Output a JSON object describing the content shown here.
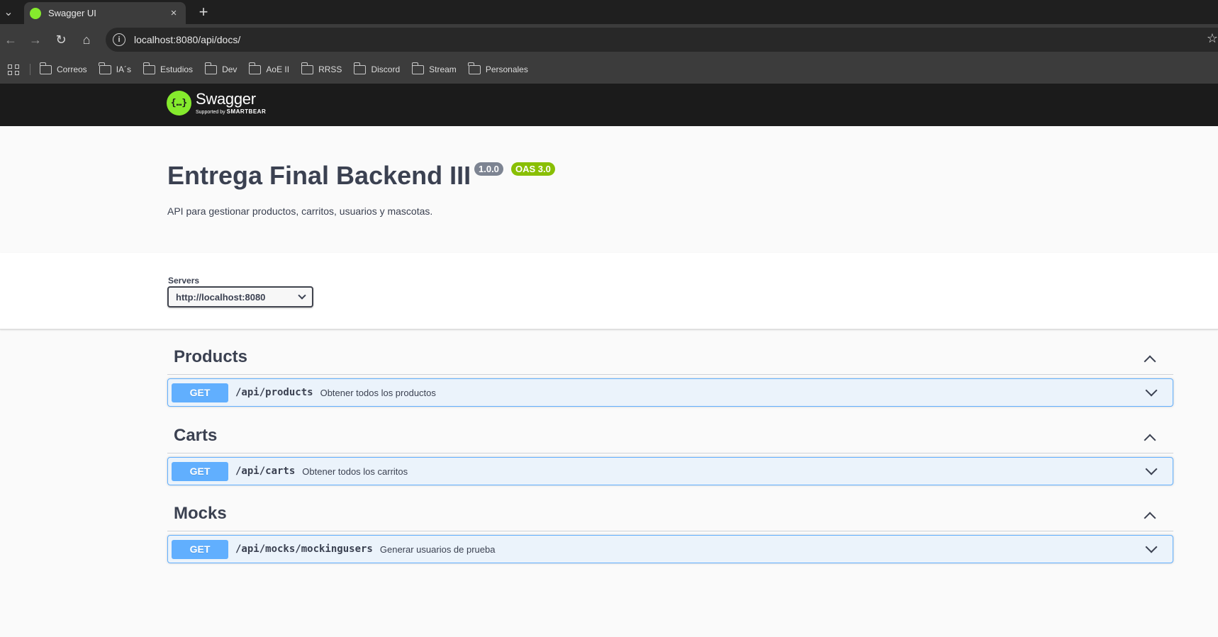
{
  "browser": {
    "tab_title": "Swagger UI",
    "tab_close": "×",
    "new_tab": "+",
    "url": "localhost:8080/api/docs/",
    "bookmarks": [
      {
        "label": "Correos"
      },
      {
        "label": "IA´s"
      },
      {
        "label": "Estudios"
      },
      {
        "label": "Dev"
      },
      {
        "label": "AoE II"
      },
      {
        "label": "RRSS"
      },
      {
        "label": "Discord"
      },
      {
        "label": "Stream"
      },
      {
        "label": "Personales"
      }
    ]
  },
  "swagger": {
    "logo_name": "Swagger",
    "logo_sub_prefix": "Supported by",
    "logo_sub_brand": "SMARTBEAR",
    "logo_glyph": "{…}",
    "accent_color": "#85ea2d"
  },
  "info": {
    "title": "Entrega Final Backend III",
    "version": "1.0.0",
    "oas": "OAS 3.0",
    "description": "API para gestionar productos, carritos, usuarios y mascotas."
  },
  "servers": {
    "label": "Servers",
    "selected": "http://localhost:8080"
  },
  "tags": [
    {
      "name": "Products",
      "operations": [
        {
          "method": "GET",
          "path": "/api/products",
          "summary": "Obtener todos los productos"
        }
      ]
    },
    {
      "name": "Carts",
      "operations": [
        {
          "method": "GET",
          "path": "/api/carts",
          "summary": "Obtener todos los carritos"
        }
      ]
    },
    {
      "name": "Mocks",
      "operations": [
        {
          "method": "GET",
          "path": "/api/mocks/mockingusers",
          "summary": "Generar usuarios de prueba"
        }
      ]
    }
  ],
  "colors": {
    "get": "#61affe",
    "get_bg": "#ebf3fb",
    "version_badge": "#7d8492",
    "oas_badge": "#89bf04"
  }
}
